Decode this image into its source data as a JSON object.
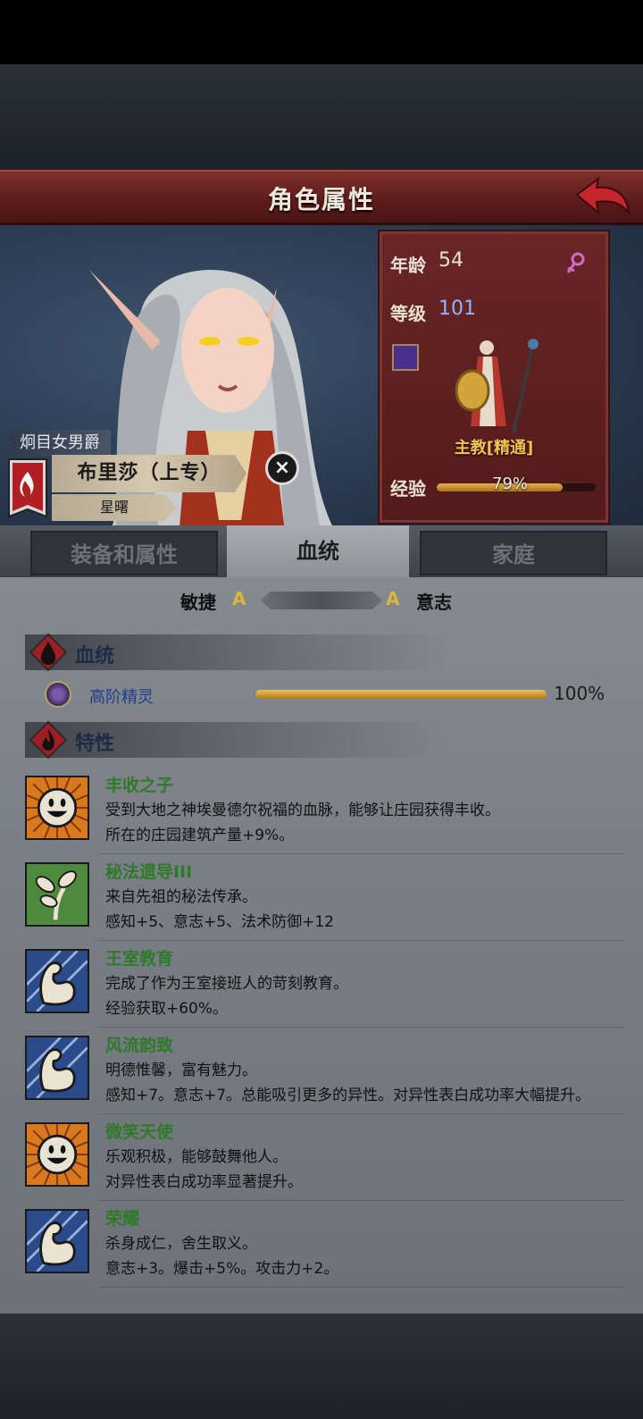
{
  "header": {
    "title": "角色属性"
  },
  "character": {
    "rank": "炯目女男爵",
    "name": "布里莎（上专）",
    "title": "星曙",
    "age_label": "年龄",
    "age": "54",
    "level_label": "等级",
    "level": "101",
    "class_name": "主教[精通]",
    "exp_label": "经验",
    "exp_text": "79%",
    "exp_fraction": 0.79
  },
  "tabs": [
    {
      "label": "装备和属性"
    },
    {
      "label": "血统"
    },
    {
      "label": "家庭"
    }
  ],
  "attributes": {
    "left_name": "敏捷",
    "left_grade": "A",
    "right_grade": "A",
    "right_name": "意志"
  },
  "lineage_section": {
    "title": "血统",
    "name": "高阶精灵",
    "percent_text": "100%",
    "fraction": 1.0
  },
  "traits_section": {
    "title": "特性"
  },
  "traits": [
    {
      "name": "丰收之子",
      "line1": "受到大地之神埃曼德尔祝福的血脉，能够让庄园获得丰收。",
      "line2": "所在的庄园建筑产量+9%。",
      "icon": "smiley-face-icon"
    },
    {
      "name": "秘法遗导III",
      "line1": "来自先祖的秘法传承。",
      "line2": "感知+5、意志+5、法术防御+12",
      "icon": "leaf-sprout-icon"
    },
    {
      "name": "王室教育",
      "line1": "完成了作为王室接班人的苛刻教育。",
      "line2": "经验获取+60%。",
      "icon": "flexed-arm-icon"
    },
    {
      "name": "风流韵致",
      "line1": "明德惟馨，富有魅力。",
      "line2": "感知+7。意志+7。总能吸引更多的异性。对异性表白成功率大幅提升。",
      "icon": "flexed-arm-icon"
    },
    {
      "name": "微笑天使",
      "line1": "乐观积极，能够鼓舞他人。",
      "line2": "对异性表白成功率显著提升。",
      "icon": "smiley-face-icon"
    },
    {
      "name": "荣耀",
      "line1": "杀身成仁，舍生取义。",
      "line2": "意志+3。爆击+5%。攻击力+2。",
      "icon": "flexed-arm-icon"
    }
  ],
  "colors": {
    "title_bar": "#6a2525",
    "trait_name": "#2e7a2a",
    "lineage_name": "#1f3f8a",
    "grade": "#d8b640",
    "level_value": "#8fb6ff"
  }
}
